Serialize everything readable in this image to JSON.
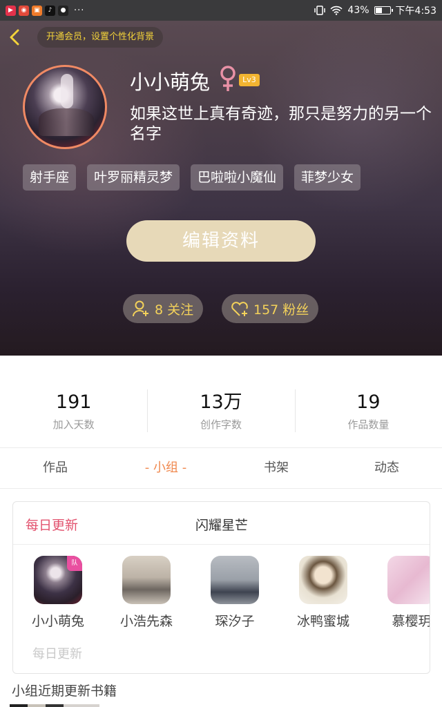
{
  "status_bar": {
    "apps": [
      {
        "icon": "video-app-icon",
        "color": "#e3324b",
        "glyph": "▶"
      },
      {
        "icon": "app-red-icon",
        "color": "#e24a3a",
        "glyph": "◉"
      },
      {
        "icon": "app-orange-icon",
        "color": "#ef7b2a",
        "glyph": "▣"
      },
      {
        "icon": "tiktok-icon",
        "color": "#111111",
        "glyph": "♪"
      },
      {
        "icon": "app-dark-icon",
        "color": "#222222",
        "glyph": "●"
      }
    ],
    "more": "···",
    "battery_text": "43%",
    "battery_level": 0.43,
    "time": "下午4:53"
  },
  "header": {
    "vip_text": "开通会员，设置个性化背景",
    "nickname": "小小萌兔",
    "level": "Lv3",
    "signature": "如果这世上真有奇迹，那只是努力的另一个名字",
    "tags": [
      "射手座",
      "叶罗丽精灵梦",
      "巴啦啦小魔仙",
      "菲梦少女"
    ],
    "edit_button": "编辑资料",
    "following": "8 关注",
    "followers": "157 粉丝",
    "colors": {
      "accent": "#f3d33a",
      "avatar_border": "#f08a64",
      "edit_button_bg": "#e7d9b8"
    }
  },
  "stats": [
    {
      "value": "191",
      "label": "加入天数"
    },
    {
      "value": "13万",
      "label": "创作字数"
    },
    {
      "value": "19",
      "label": "作品数量"
    }
  ],
  "tabs": [
    {
      "label": "作品",
      "active": false
    },
    {
      "label": "- 小组 -",
      "active": true
    },
    {
      "label": "书架",
      "active": false
    },
    {
      "label": "动态",
      "active": false
    }
  ],
  "group": {
    "daily_update": "每日更新",
    "name": "闪耀星芒",
    "members": [
      {
        "name": "小小萌兔",
        "badge": "队"
      },
      {
        "name": "小浩先森"
      },
      {
        "name": "琛汐子"
      },
      {
        "name": "冰鸭蜜城"
      },
      {
        "name": "慕樱玥"
      }
    ],
    "footer_daily_update": "每日更新"
  },
  "recent_books_title": "小组近期更新书籍"
}
